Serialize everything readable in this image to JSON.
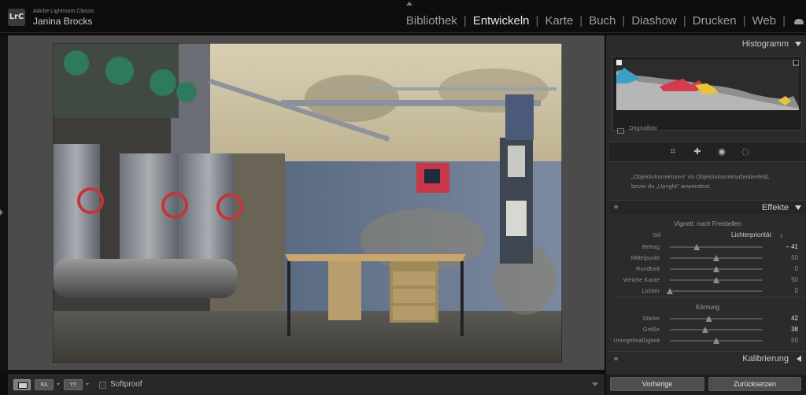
{
  "header": {
    "logo_text": "LrC",
    "app_name": "Adobe Lightroom Classic",
    "user_name": "Janina Brocks",
    "modules": [
      {
        "label": "Bibliothek",
        "active": false
      },
      {
        "label": "Entwickeln",
        "active": true
      },
      {
        "label": "Karte",
        "active": false
      },
      {
        "label": "Buch",
        "active": false
      },
      {
        "label": "Diashow",
        "active": false
      },
      {
        "label": "Drucken",
        "active": false
      },
      {
        "label": "Web",
        "active": false
      }
    ]
  },
  "toolbar": {
    "ra_label": "RA",
    "yy_label": "YY",
    "softproof_label": "Softproof"
  },
  "panels": {
    "histogram_title": "Histogramm",
    "original_photo_label": "Originalfoto",
    "hint_line1": "„Objektivkorrekturen\" im Objektivkorrekturbedienfeld,",
    "hint_line2": "bevor du „Upright\" anwendest.",
    "effects_title": "Effekte",
    "vignette_title": "Vignett. nach Freistellen",
    "style_label": "Stil",
    "style_value": "Lichterpriorität",
    "vignette_sliders": [
      {
        "label": "Betrag",
        "value": "– 41",
        "pos": 0.29,
        "highlight": true
      },
      {
        "label": "Mittelpunkt",
        "value": "50",
        "pos": 0.5,
        "highlight": false
      },
      {
        "label": "Rundheit",
        "value": "0",
        "pos": 0.5,
        "highlight": false
      },
      {
        "label": "Weiche Kante",
        "value": "50",
        "pos": 0.5,
        "highlight": false
      },
      {
        "label": "Lichter",
        "value": "0",
        "pos": 0.0,
        "highlight": false
      }
    ],
    "grain_title": "Körnung",
    "grain_sliders": [
      {
        "label": "Stärke",
        "value": "42",
        "pos": 0.42,
        "highlight": true
      },
      {
        "label": "Größe",
        "value": "38",
        "pos": 0.38,
        "highlight": true
      },
      {
        "label": "Unregelmäßigkeit",
        "value": "50",
        "pos": 0.5,
        "highlight": false
      }
    ],
    "calibration_title": "Kalibrierung"
  },
  "buttons": {
    "previous": "Vorherige",
    "reset": "Zurücksetzen"
  },
  "icons": {
    "crop": "crop-icon",
    "heal": "bandage-icon",
    "redeye": "eye-icon",
    "mask": "mask-circle-icon"
  }
}
